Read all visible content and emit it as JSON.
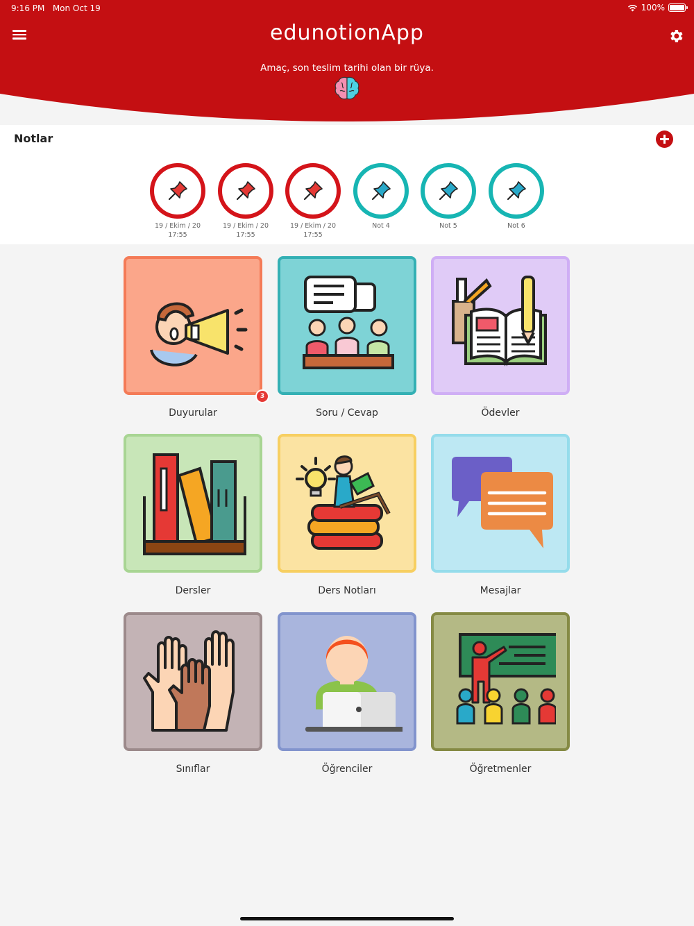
{
  "status_bar": {
    "time": "9:16 PM",
    "date": "Mon Oct 19",
    "battery": "100%"
  },
  "header": {
    "title": "edunotionApp",
    "motto": "Amaç, son teslim tarihi olan bir rüya.",
    "bg_color": "#c40f12"
  },
  "notes": {
    "title": "Notlar",
    "items": [
      {
        "line1": "19 / Ekim / 20",
        "line2": "17:55",
        "color": "red"
      },
      {
        "line1": "19 / Ekim / 20",
        "line2": "17:55",
        "color": "red"
      },
      {
        "line1": "19 / Ekim / 20",
        "line2": "17:55",
        "color": "red"
      },
      {
        "line1": "Not 4",
        "line2": "",
        "color": "teal"
      },
      {
        "line1": "Not 5",
        "line2": "",
        "color": "teal"
      },
      {
        "line1": "Not 6",
        "line2": "",
        "color": "teal"
      }
    ]
  },
  "tiles": [
    {
      "label": "Duyurular",
      "bg": "#fba68a",
      "border": "#f47b57",
      "icon": "megaphone-icon",
      "badge": "3"
    },
    {
      "label": "Soru / Cevap",
      "bg": "#7ed3d6",
      "border": "#34b0b4",
      "icon": "discussion-icon"
    },
    {
      "label": "Ödevler",
      "bg": "#e0cbf7",
      "border": "#cfaef5",
      "icon": "homework-icon"
    },
    {
      "label": "Dersler",
      "bg": "#c8e6b8",
      "border": "#a8d593",
      "icon": "books-icon"
    },
    {
      "label": "Ders Notları",
      "bg": "#fbe3a2",
      "border": "#f7cf61",
      "icon": "reader-icon"
    },
    {
      "label": "Mesajlar",
      "bg": "#bde8f3",
      "border": "#95dceb",
      "icon": "chat-bubbles-icon"
    },
    {
      "label": "Sınıflar",
      "bg": "#c3b3b5",
      "border": "#9c8a8b",
      "icon": "raised-hands-icon"
    },
    {
      "label": "Öğrenciler",
      "bg": "#a9b5dd",
      "border": "#8294cd",
      "icon": "student-icon"
    },
    {
      "label": "Öğretmenler",
      "bg": "#b4b985",
      "border": "#858a44",
      "icon": "teacher-icon"
    }
  ]
}
